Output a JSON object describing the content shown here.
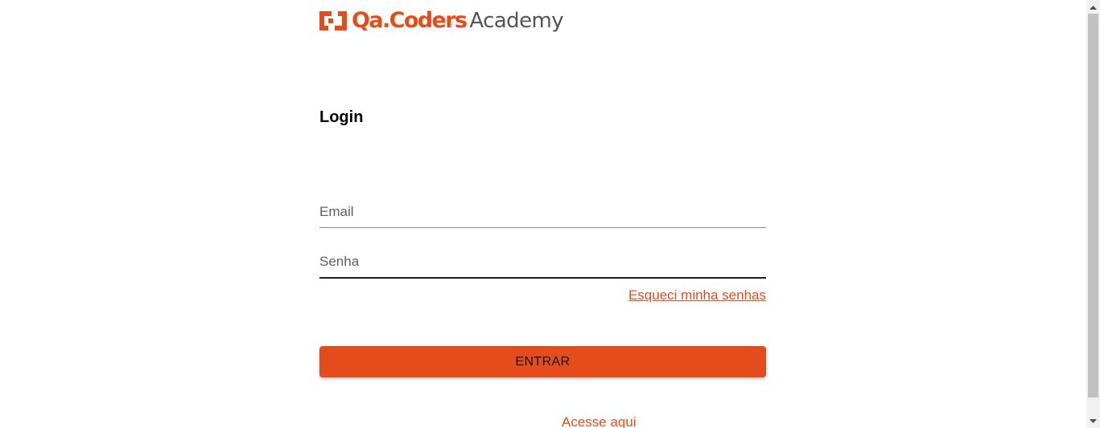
{
  "brand": {
    "name": "Qa.Coders",
    "sub": "Academy",
    "accent_color": "#e44c1b",
    "logo_icon": "qacoders-bracket-logo-icon"
  },
  "login": {
    "title": "Login",
    "email_placeholder": "Email",
    "email_value": "",
    "password_placeholder": "Senha",
    "password_value": "",
    "forgot_link": "Esqueci minha senhas",
    "submit_label": "ENTRAR",
    "access_link": "Acesse aqui"
  },
  "scrollbar": {
    "up_icon": "scroll-up-arrow-icon",
    "down_icon": "scroll-down-arrow-icon"
  }
}
